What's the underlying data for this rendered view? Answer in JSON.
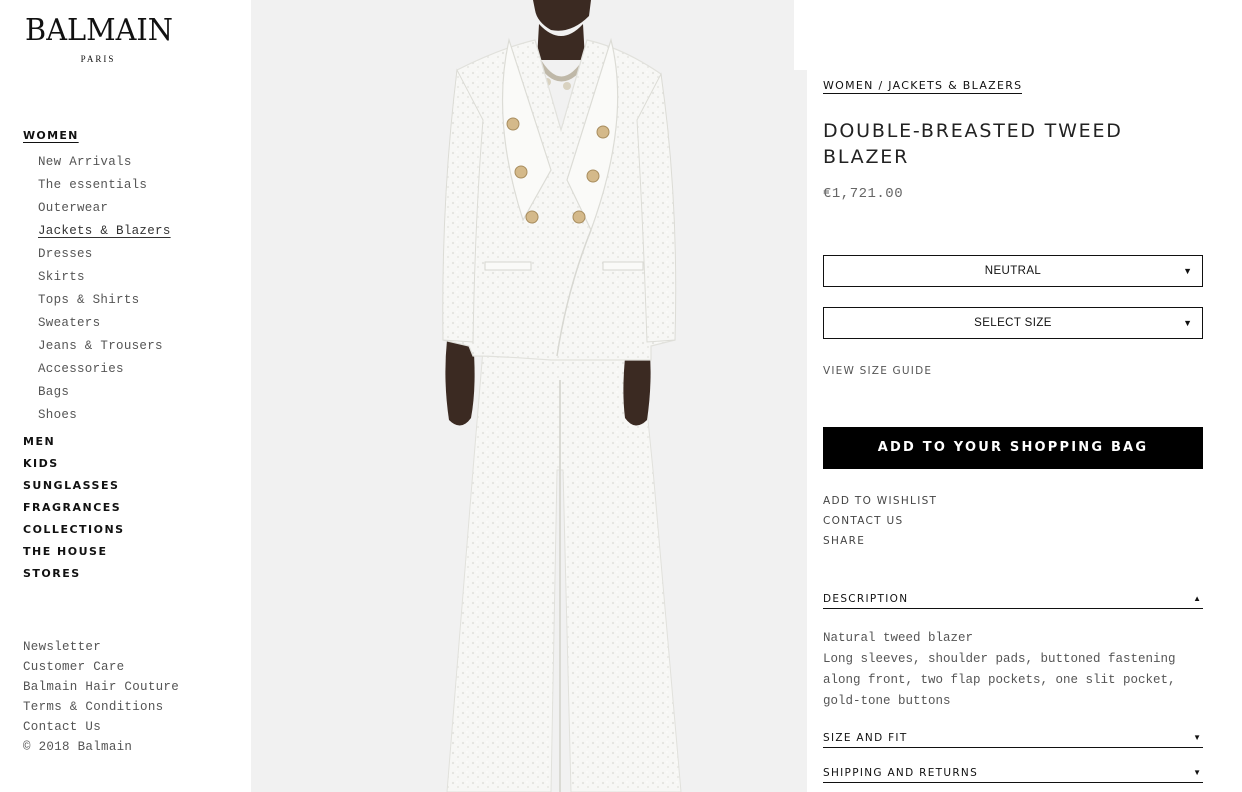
{
  "brand": {
    "name": "BALMAIN",
    "sub": "PARIS"
  },
  "sidebar": {
    "women_label": "WOMEN",
    "sub_items": [
      {
        "label": "New Arrivals",
        "active": false
      },
      {
        "label": "The essentials",
        "active": false
      },
      {
        "label": "Outerwear",
        "active": false
      },
      {
        "label": "Jackets & Blazers",
        "active": true
      },
      {
        "label": "Dresses",
        "active": false
      },
      {
        "label": "Skirts",
        "active": false
      },
      {
        "label": "Tops & Shirts",
        "active": false
      },
      {
        "label": "Sweaters",
        "active": false
      },
      {
        "label": "Jeans & Trousers",
        "active": false
      },
      {
        "label": "Accessories",
        "active": false
      },
      {
        "label": "Bags",
        "active": false
      },
      {
        "label": "Shoes",
        "active": false
      }
    ],
    "main_items": [
      "MEN",
      "KIDS",
      "SUNGLASSES",
      "FRAGRANCES",
      "COLLECTIONS",
      "THE HOUSE",
      "STORES"
    ],
    "footer_items": [
      "Newsletter",
      "Customer Care",
      "Balmain Hair Couture",
      "Terms & Conditions",
      "Contact Us"
    ],
    "copyright": "© 2018 Balmain"
  },
  "product": {
    "breadcrumb": "WOMEN / JACKETS & BLAZERS",
    "title": "DOUBLE-BREASTED TWEED BLAZER",
    "price": "€1,721.00",
    "color_select": "NEUTRAL",
    "size_select": "SELECT SIZE",
    "size_guide": "VIEW SIZE GUIDE",
    "add_to_bag": "ADD TO YOUR SHOPPING BAG",
    "actions": {
      "wishlist": "ADD TO WISHLIST",
      "contact": "CONTACT US",
      "share": "SHARE"
    },
    "description": {
      "header": "DESCRIPTION",
      "line1": "Natural tweed blazer",
      "line2": "Long sleeves, shoulder pads, buttoned fastening along front, two flap pockets, one slit pocket, gold-tone buttons"
    },
    "size_fit_header": "SIZE AND FIT",
    "shipping_header": "SHIPPING AND RETURNS"
  },
  "icons": {
    "dropdown": "triangle-down-icon",
    "collapse": "triangle-up-icon"
  },
  "colors": {
    "accent": "#000000",
    "image_bg": "#f1f1f1",
    "text_muted": "#555555"
  }
}
